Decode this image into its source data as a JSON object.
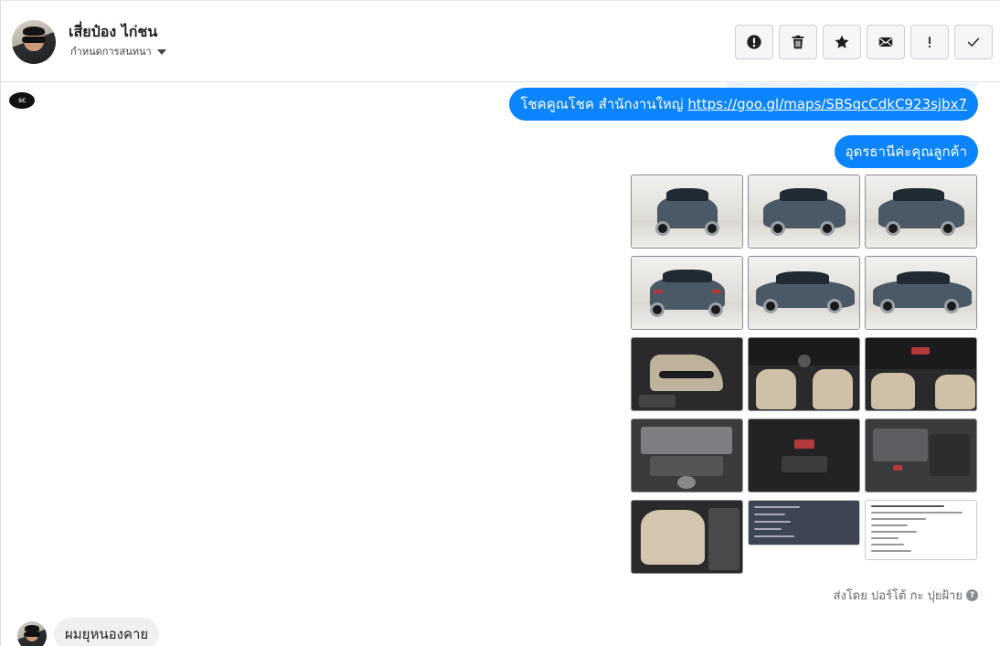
{
  "header": {
    "contact_name": "เสี่ยป๋อง ไก่ชน",
    "assign_label": "กำหนดการสนทนา",
    "toolbar": [
      {
        "name": "spam-button",
        "icon": "exclamation-circle-icon"
      },
      {
        "name": "delete-button",
        "icon": "trash-icon"
      },
      {
        "name": "star-button",
        "icon": "star-icon"
      },
      {
        "name": "mark-unread-button",
        "icon": "envelope-icon"
      },
      {
        "name": "follow-up-button",
        "icon": "exclamation-icon"
      },
      {
        "name": "mark-done-button",
        "icon": "check-icon"
      }
    ]
  },
  "messages": {
    "page_logo_text": "SC",
    "out_1_text": "โชคคูณโชค สำนักงานใหญ่ ",
    "out_1_link": "https://goo.gl/maps/SBSqcCdkC923sjbx7",
    "out_2_text": "อุดรธานีค่ะคุณลูกค้า",
    "gallery_count": 15,
    "sent_by": "ส่งโดย ปอร์โต้ กะ ปุยฝ้าย",
    "help_icon": "question-circle-icon",
    "in_1_text": "ผมยุหนองคาย"
  },
  "colors": {
    "outgoing_bubble": "#0b84ff",
    "incoming_bubble": "#f0f0f0",
    "toolbar_bg": "#f5f6f7"
  }
}
